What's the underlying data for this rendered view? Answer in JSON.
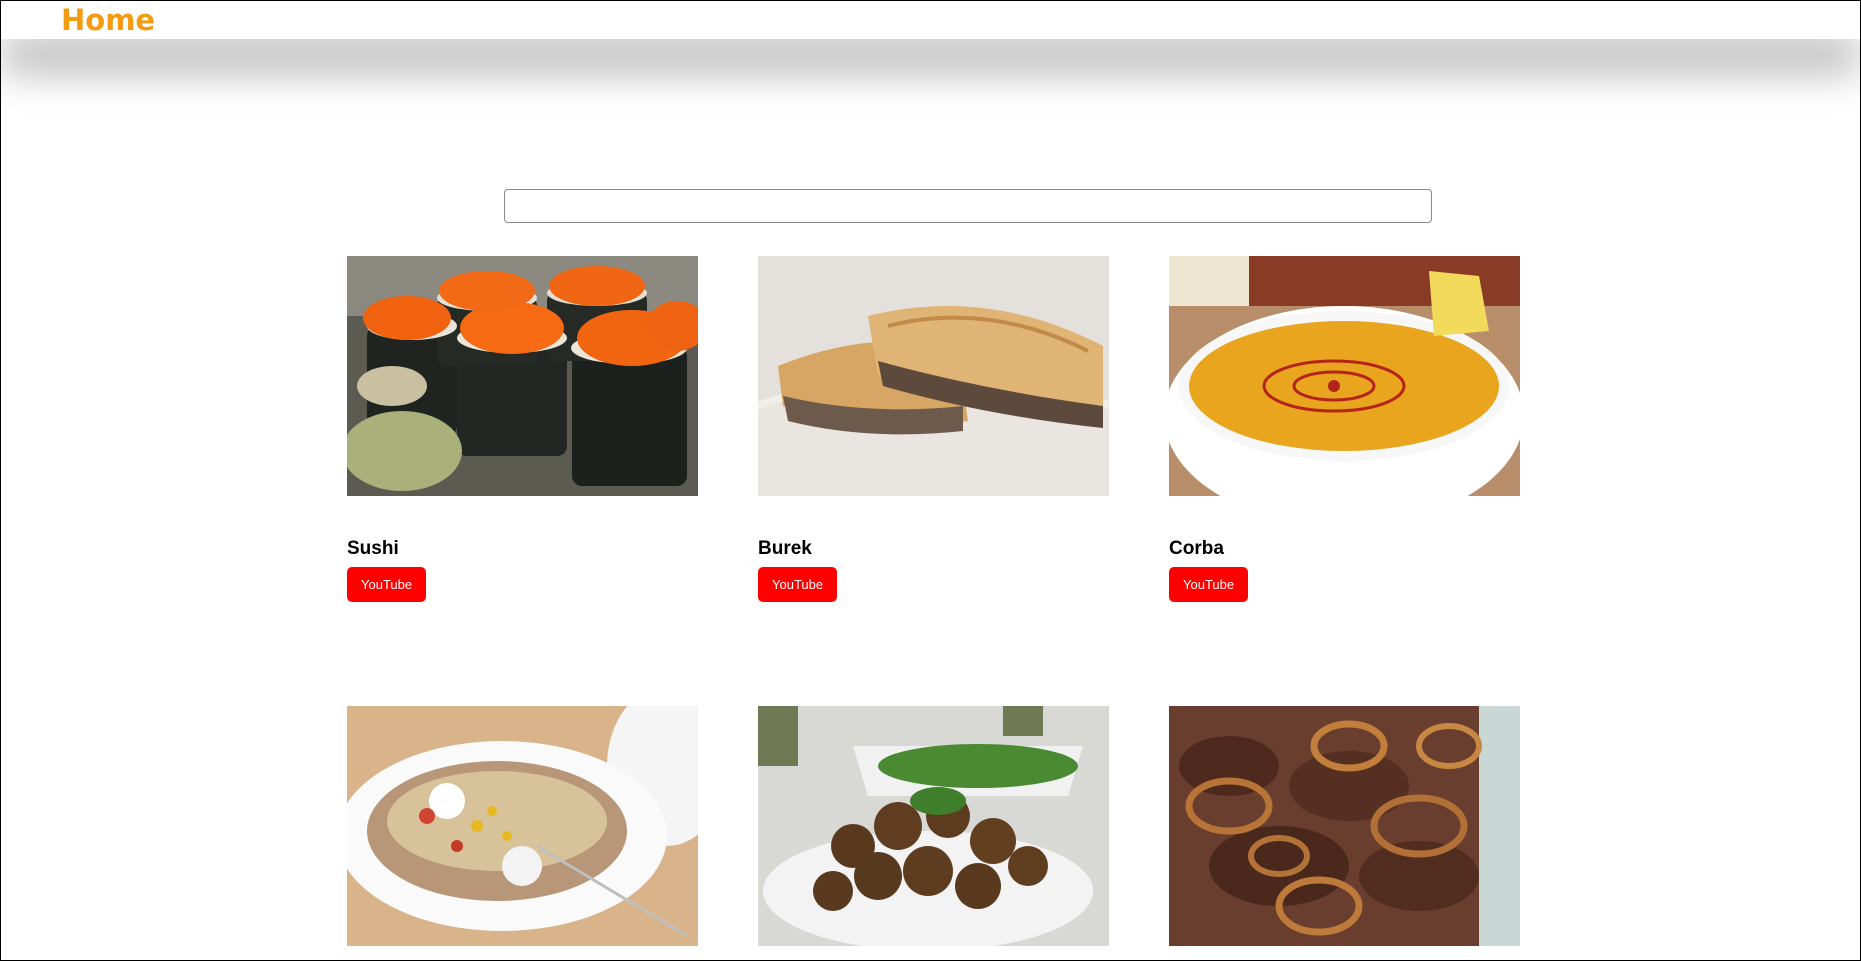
{
  "nav": {
    "home_label": "Home",
    "home_color": "#f39c12"
  },
  "search": {
    "placeholder": "",
    "value": ""
  },
  "cards": [
    {
      "title": "Sushi",
      "button_label": "YouTube",
      "image": "sushi-image"
    },
    {
      "title": "Burek",
      "button_label": "YouTube",
      "image": "burek-image"
    },
    {
      "title": "Corba",
      "button_label": "YouTube",
      "image": "corba-image"
    },
    {
      "title": "",
      "button_label": "",
      "image": "stuffed-potato-image"
    },
    {
      "title": "",
      "button_label": "",
      "image": "falafel-image"
    },
    {
      "title": "",
      "button_label": "",
      "image": "liver-onions-image"
    }
  ],
  "colors": {
    "youtube_button": "#ff0000",
    "accent": "#f39c12"
  }
}
